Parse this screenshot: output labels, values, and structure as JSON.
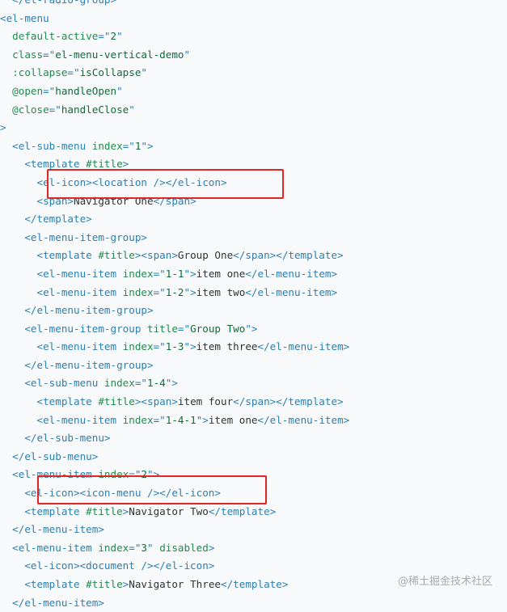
{
  "lines": [
    [
      [
        "t",
        "  </el-radio-group>"
      ]
    ],
    [
      [
        "t",
        "<el-menu"
      ]
    ],
    [
      [
        "x",
        "  "
      ],
      [
        "a",
        "default-active"
      ],
      [
        "t",
        "=\""
      ],
      [
        "s",
        "2"
      ],
      [
        "t",
        "\""
      ]
    ],
    [
      [
        "x",
        "  "
      ],
      [
        "a",
        "class"
      ],
      [
        "t",
        "=\""
      ],
      [
        "s",
        "el-menu-vertical-demo"
      ],
      [
        "t",
        "\""
      ]
    ],
    [
      [
        "x",
        "  "
      ],
      [
        "a",
        ":collapse"
      ],
      [
        "t",
        "=\""
      ],
      [
        "s",
        "isCollapse"
      ],
      [
        "t",
        "\""
      ]
    ],
    [
      [
        "x",
        "  "
      ],
      [
        "a",
        "@open"
      ],
      [
        "t",
        "=\""
      ],
      [
        "s",
        "handleOpen"
      ],
      [
        "t",
        "\""
      ]
    ],
    [
      [
        "x",
        "  "
      ],
      [
        "a",
        "@close"
      ],
      [
        "t",
        "=\""
      ],
      [
        "s",
        "handleClose"
      ],
      [
        "t",
        "\""
      ]
    ],
    [
      [
        "t",
        ">"
      ]
    ],
    [
      [
        "x",
        "  "
      ],
      [
        "t",
        "<el-sub-menu "
      ],
      [
        "a",
        "index"
      ],
      [
        "t",
        "=\""
      ],
      [
        "s",
        "1"
      ],
      [
        "t",
        "\">"
      ]
    ],
    [
      [
        "x",
        "    "
      ],
      [
        "t",
        "<template "
      ],
      [
        "a",
        "#title"
      ],
      [
        "t",
        ">"
      ]
    ],
    [
      [
        "x",
        "      "
      ],
      [
        "t",
        "<el-icon><location /></el-icon>"
      ]
    ],
    [
      [
        "x",
        "      "
      ],
      [
        "t",
        "<span>"
      ],
      [
        "x",
        "Navigator One"
      ],
      [
        "t",
        "</span>"
      ]
    ],
    [
      [
        "x",
        "    "
      ],
      [
        "t",
        "</template>"
      ]
    ],
    [
      [
        "x",
        "    "
      ],
      [
        "t",
        "<el-menu-item-group>"
      ]
    ],
    [
      [
        "x",
        "      "
      ],
      [
        "t",
        "<template "
      ],
      [
        "a",
        "#title"
      ],
      [
        "t",
        "><span>"
      ],
      [
        "x",
        "Group One"
      ],
      [
        "t",
        "</span></template>"
      ]
    ],
    [
      [
        "x",
        "      "
      ],
      [
        "t",
        "<el-menu-item "
      ],
      [
        "a",
        "index"
      ],
      [
        "t",
        "=\""
      ],
      [
        "s",
        "1-1"
      ],
      [
        "t",
        "\">"
      ],
      [
        "x",
        "item one"
      ],
      [
        "t",
        "</el-menu-item>"
      ]
    ],
    [
      [
        "x",
        "      "
      ],
      [
        "t",
        "<el-menu-item "
      ],
      [
        "a",
        "index"
      ],
      [
        "t",
        "=\""
      ],
      [
        "s",
        "1-2"
      ],
      [
        "t",
        "\">"
      ],
      [
        "x",
        "item two"
      ],
      [
        "t",
        "</el-menu-item>"
      ]
    ],
    [
      [
        "x",
        "    "
      ],
      [
        "t",
        "</el-menu-item-group>"
      ]
    ],
    [
      [
        "x",
        "    "
      ],
      [
        "t",
        "<el-menu-item-group "
      ],
      [
        "a",
        "title"
      ],
      [
        "t",
        "=\""
      ],
      [
        "s",
        "Group Two"
      ],
      [
        "t",
        "\">"
      ]
    ],
    [
      [
        "x",
        "      "
      ],
      [
        "t",
        "<el-menu-item "
      ],
      [
        "a",
        "index"
      ],
      [
        "t",
        "=\""
      ],
      [
        "s",
        "1-3"
      ],
      [
        "t",
        "\">"
      ],
      [
        "x",
        "item three"
      ],
      [
        "t",
        "</el-menu-item>"
      ]
    ],
    [
      [
        "x",
        "    "
      ],
      [
        "t",
        "</el-menu-item-group>"
      ]
    ],
    [
      [
        "x",
        "    "
      ],
      [
        "t",
        "<el-sub-menu "
      ],
      [
        "a",
        "index"
      ],
      [
        "t",
        "=\""
      ],
      [
        "s",
        "1-4"
      ],
      [
        "t",
        "\">"
      ]
    ],
    [
      [
        "x",
        "      "
      ],
      [
        "t",
        "<template "
      ],
      [
        "a",
        "#title"
      ],
      [
        "t",
        "><span>"
      ],
      [
        "x",
        "item four"
      ],
      [
        "t",
        "</span></template>"
      ]
    ],
    [
      [
        "x",
        "      "
      ],
      [
        "t",
        "<el-menu-item "
      ],
      [
        "a",
        "index"
      ],
      [
        "t",
        "=\""
      ],
      [
        "s",
        "1-4-1"
      ],
      [
        "t",
        "\">"
      ],
      [
        "x",
        "item one"
      ],
      [
        "t",
        "</el-menu-item>"
      ]
    ],
    [
      [
        "x",
        "    "
      ],
      [
        "t",
        "</el-sub-menu>"
      ]
    ],
    [
      [
        "x",
        "  "
      ],
      [
        "t",
        "</el-sub-menu>"
      ]
    ],
    [
      [
        "x",
        "  "
      ],
      [
        "t",
        "<el-menu-item "
      ],
      [
        "a",
        "index"
      ],
      [
        "t",
        "=\""
      ],
      [
        "s",
        "2"
      ],
      [
        "t",
        "\">"
      ]
    ],
    [
      [
        "x",
        "    "
      ],
      [
        "t",
        "<el-icon><icon-menu /></el-icon>"
      ]
    ],
    [
      [
        "x",
        "    "
      ],
      [
        "t",
        "<template "
      ],
      [
        "a",
        "#title"
      ],
      [
        "t",
        ">"
      ],
      [
        "x",
        "Navigator Two"
      ],
      [
        "t",
        "</template>"
      ]
    ],
    [
      [
        "x",
        "  "
      ],
      [
        "t",
        "</el-menu-item>"
      ]
    ],
    [
      [
        "x",
        "  "
      ],
      [
        "t",
        "<el-menu-item "
      ],
      [
        "a",
        "index"
      ],
      [
        "t",
        "=\""
      ],
      [
        "s",
        "3"
      ],
      [
        "t",
        "\" "
      ],
      [
        "a",
        "disabled"
      ],
      [
        "t",
        ">"
      ]
    ],
    [
      [
        "x",
        "    "
      ],
      [
        "t",
        "<el-icon><document /></el-icon>"
      ]
    ],
    [
      [
        "x",
        "    "
      ],
      [
        "t",
        "<template "
      ],
      [
        "a",
        "#title"
      ],
      [
        "t",
        ">"
      ],
      [
        "x",
        "Navigator Three"
      ],
      [
        "t",
        "</template>"
      ]
    ],
    [
      [
        "x",
        "  "
      ],
      [
        "t",
        "</el-menu-item>"
      ]
    ]
  ],
  "watermark": "@稀土掘金技术社区",
  "colors": {
    "tag": "#2c7fb1",
    "attr": "#228a50",
    "string": "#116b3a",
    "text": "#333333",
    "highlight_box": "#e02525",
    "background": "#f8f9fa"
  }
}
